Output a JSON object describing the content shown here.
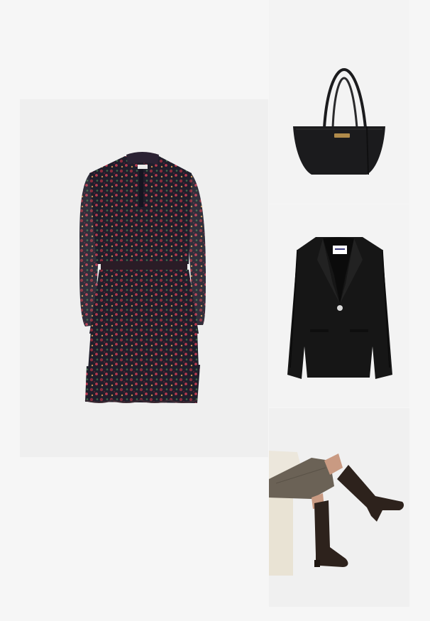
{
  "products": [
    {
      "id": "dress",
      "icon": "floral-dress-image"
    },
    {
      "id": "bag",
      "icon": "tote-bag-image"
    },
    {
      "id": "blazer",
      "icon": "black-blazer-image"
    },
    {
      "id": "boots",
      "icon": "knee-high-boots-image"
    }
  ],
  "colors": {
    "page_bg": "#f6f6f6",
    "dress_base": "#1f1e2b",
    "dress_print": [
      "#8a2a3c",
      "#b43a4f",
      "#3f6b4a",
      "#c98a4a"
    ],
    "bag": "#1b1b1d",
    "bag_plate": "#b08a4a",
    "blazer": "#161616",
    "skirt": "#6b6256",
    "boots": "#2d221c",
    "stool": "#e9e3d4"
  }
}
